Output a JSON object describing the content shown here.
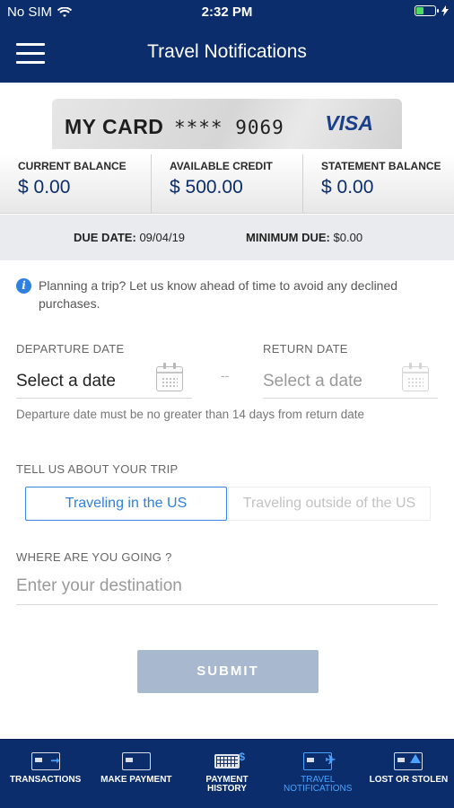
{
  "status_bar": {
    "carrier": "No SIM",
    "time": "2:32 PM"
  },
  "header": {
    "title": "Travel Notifications",
    "menu_icon": "hamburger-menu-icon"
  },
  "card": {
    "name": "MY CARD",
    "number": "**** 9069",
    "brand": "VISA"
  },
  "balances": [
    {
      "label": "CURRENT BALANCE",
      "value": "$ 0.00"
    },
    {
      "label": "AVAILABLE CREDIT",
      "value": "$ 500.00"
    },
    {
      "label": "STATEMENT BALANCE",
      "value": "$ 0.00"
    }
  ],
  "due": {
    "due_date_label": "DUE DATE:",
    "due_date": "09/04/19",
    "minimum_due_label": "MINIMUM DUE:",
    "minimum_due": "$0.00"
  },
  "info": {
    "text": "Planning a trip? Let us know ahead of time to avoid any declined purchases.",
    "icon": "info-icon"
  },
  "dates": {
    "departure_label": "DEPARTURE DATE",
    "departure_value": "Select a date",
    "separator": "--",
    "return_label": "RETURN DATE",
    "return_value": "Select a date",
    "hint": "Departure date must be no greater than 14 days from return date"
  },
  "trip": {
    "label": "TELL US ABOUT YOUR TRIP",
    "options": [
      "Traveling in the US",
      "Traveling outside of the US"
    ],
    "selected": "Traveling in the US"
  },
  "destination": {
    "label": "WHERE ARE YOU GOING ?",
    "placeholder": "Enter your destination"
  },
  "submit_label": "SUBMIT",
  "tabs": [
    {
      "label": "TRANSACTIONS",
      "icon": "card-transfer-icon"
    },
    {
      "label": "MAKE PAYMENT",
      "icon": "card-icon"
    },
    {
      "label_line1": "PAYMENT",
      "label_line2": "HISTORY",
      "icon": "payment-history-icon"
    },
    {
      "label_line1": "TRAVEL",
      "label_line2": "NOTIFICATIONS",
      "icon": "travel-icon",
      "active": true
    },
    {
      "label": "LOST OR STOLEN",
      "icon": "lost-card-warning-icon"
    }
  ],
  "colors": {
    "nav": "#0b2d6b",
    "accent": "#2f80e0",
    "submit_disabled": "#a7b8cf"
  }
}
